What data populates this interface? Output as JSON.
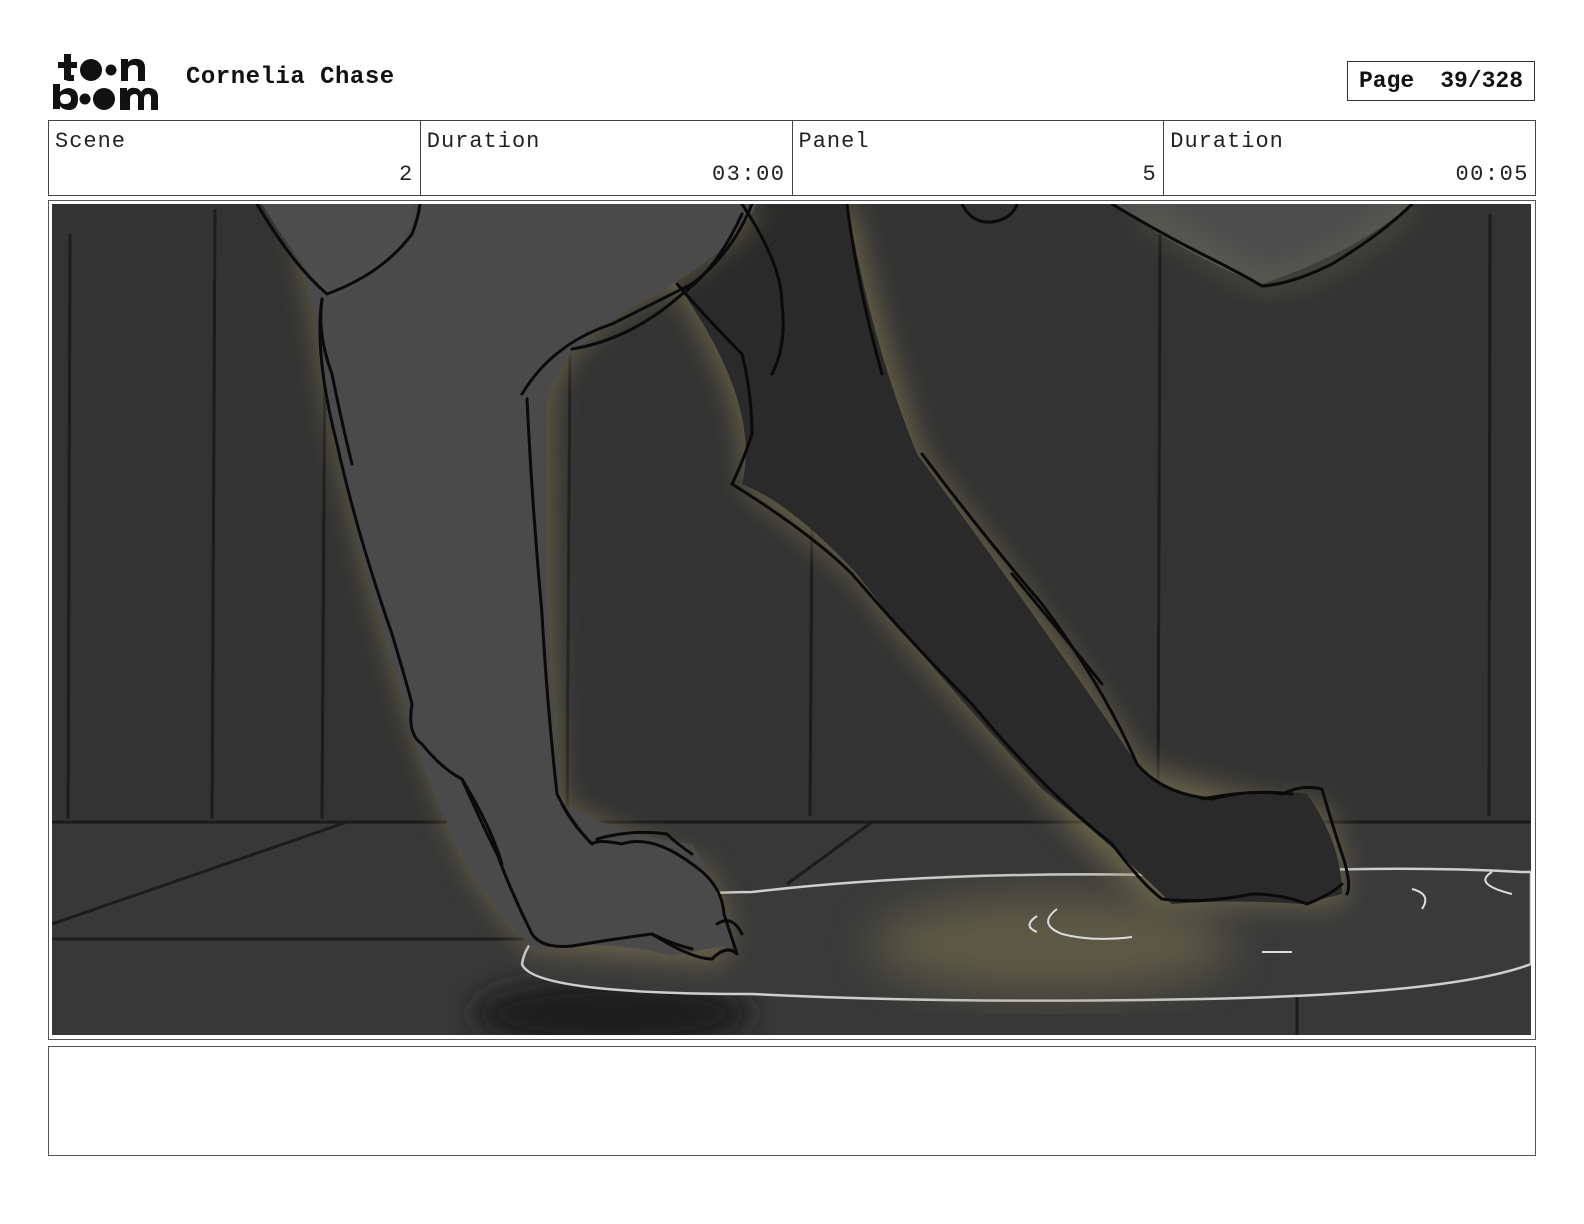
{
  "header": {
    "logo": "toon boom",
    "project_title": "Cornelia Chase",
    "page_label": "Page",
    "page_number": "39/328"
  },
  "info": {
    "scene_label": "Scene",
    "scene_value": "2",
    "scene_duration_label": "Duration",
    "scene_duration_value": "03:00",
    "panel_label": "Panel",
    "panel_value": "5",
    "panel_duration_label": "Duration",
    "panel_duration_value": "00:05"
  },
  "notes": {
    "text": ""
  }
}
